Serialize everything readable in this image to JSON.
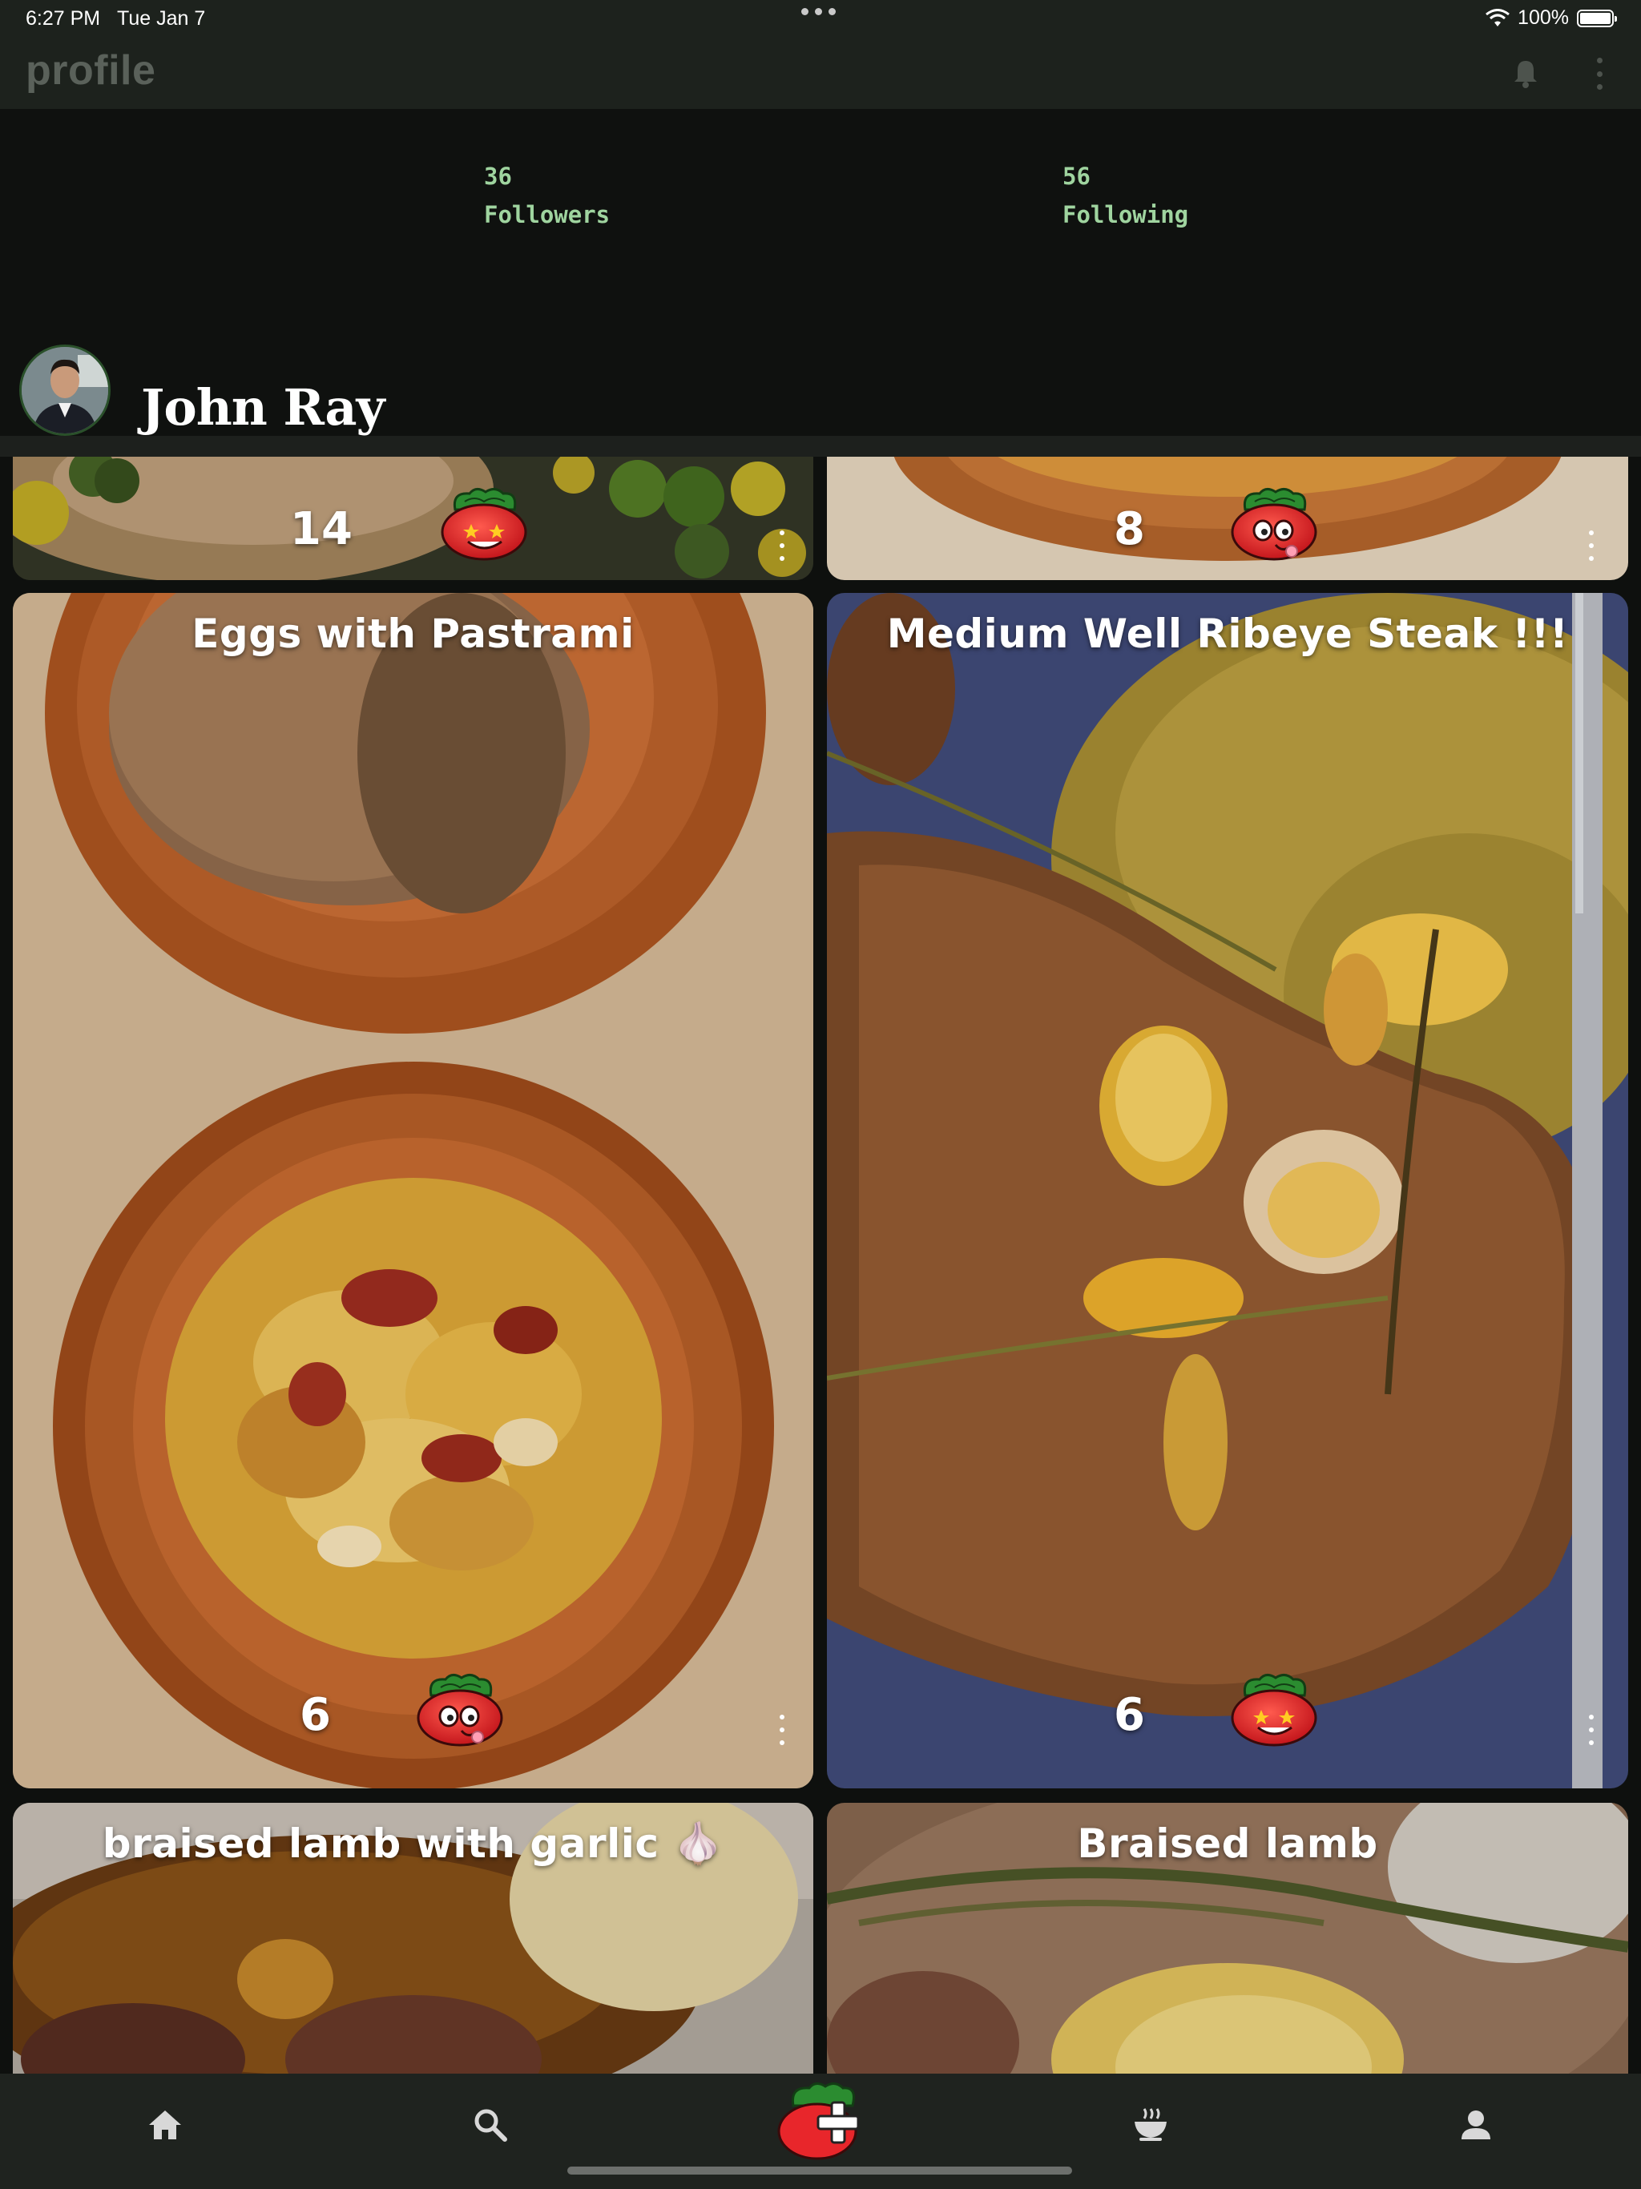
{
  "status_bar": {
    "time": "6:27 PM",
    "date": "Tue Jan 7",
    "battery": "100%"
  },
  "app_bar": {
    "title": "profile"
  },
  "profile": {
    "followers_count": "36",
    "followers_label": "Followers",
    "following_count": "56",
    "following_label": "Following",
    "name": "John Ray"
  },
  "posts": [
    {
      "title": "",
      "count": "14",
      "reaction": "star-eyes"
    },
    {
      "title": "",
      "count": "8",
      "reaction": "drool"
    },
    {
      "title": "Eggs with Pastrami",
      "count": "6",
      "reaction": "drool"
    },
    {
      "title": "Medium Well Ribeye Steak !!!",
      "count": "6",
      "reaction": "star-eyes"
    },
    {
      "title": "braised lamb with garlic 🧄",
      "count": "",
      "reaction": ""
    },
    {
      "title": "Braised lamb",
      "count": "",
      "reaction": ""
    }
  ],
  "bottom_nav": {
    "items": [
      "home-icon",
      "search-icon",
      "add-post-icon",
      "bowl-icon",
      "person-icon"
    ]
  },
  "colors": {
    "app_bar_bg": "#1d221d",
    "stat_text": "#9fd49f",
    "nav_bg": "#1f231f",
    "accent_red": "#e8262b",
    "accent_green": "#2e8a2e"
  }
}
